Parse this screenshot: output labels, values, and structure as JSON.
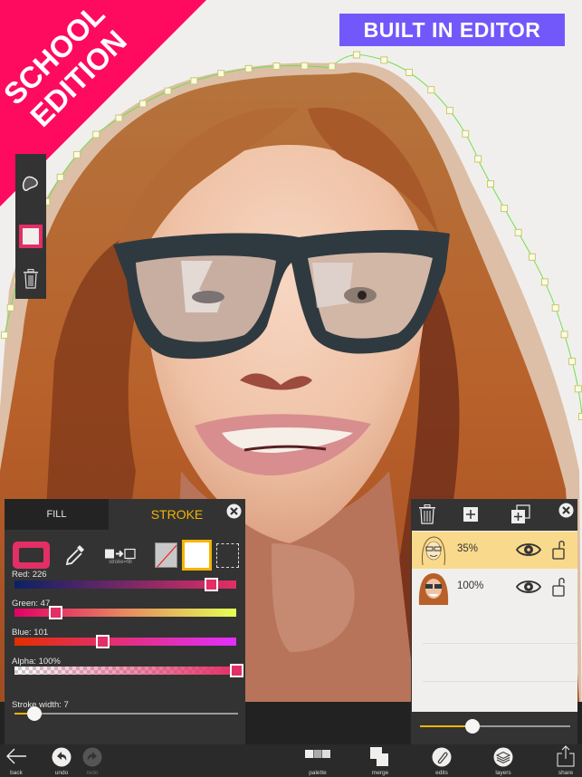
{
  "banners": {
    "school_edition_line1": "SCHOOL",
    "school_edition_line2": "EDITION",
    "built_in_editor": "BUILT IN EDITOR"
  },
  "colors": {
    "banner_pink": "#fe0a5e",
    "badge_purple": "#7258fb",
    "accent_yellow": "#f5b400",
    "stroke_color": "#e22f65",
    "path_green": "#6fe04b",
    "panel_bg": "#333333",
    "layer_selected": "#f9d98b"
  },
  "left_toolbar": {
    "icons": [
      "shape-blob-icon",
      "stroke-swatch-icon",
      "trash-icon"
    ]
  },
  "color_panel": {
    "tabs": [
      {
        "label": "FILL",
        "active": false
      },
      {
        "label": "STROKE",
        "active": true
      }
    ],
    "stroke_fill_label": "stroke=fill",
    "sliders": {
      "red": {
        "label": "Red: 226",
        "value": 226,
        "max": 255
      },
      "green": {
        "label": "Green: 47",
        "value": 47,
        "max": 255
      },
      "blue": {
        "label": "Blue: 101",
        "value": 101,
        "max": 255
      },
      "alpha": {
        "label": "Alpha: 100%",
        "value": 100,
        "max": 100
      }
    },
    "stroke_width": {
      "label": "Stroke width: 7",
      "value": 7,
      "fraction": 0.09
    }
  },
  "layers_panel": {
    "layers": [
      {
        "opacity": "35%",
        "selected": true,
        "thumb": "sketch-portrait"
      },
      {
        "opacity": "100%",
        "selected": false,
        "thumb": "color-portrait"
      }
    ],
    "opacity_slider_fraction": 0.35
  },
  "bottom_bar": {
    "back": "back",
    "undo": "undo",
    "redo": "redo",
    "palette": "palette",
    "merge": "merge",
    "edits": "edits",
    "layers": "layers",
    "share": "share"
  }
}
